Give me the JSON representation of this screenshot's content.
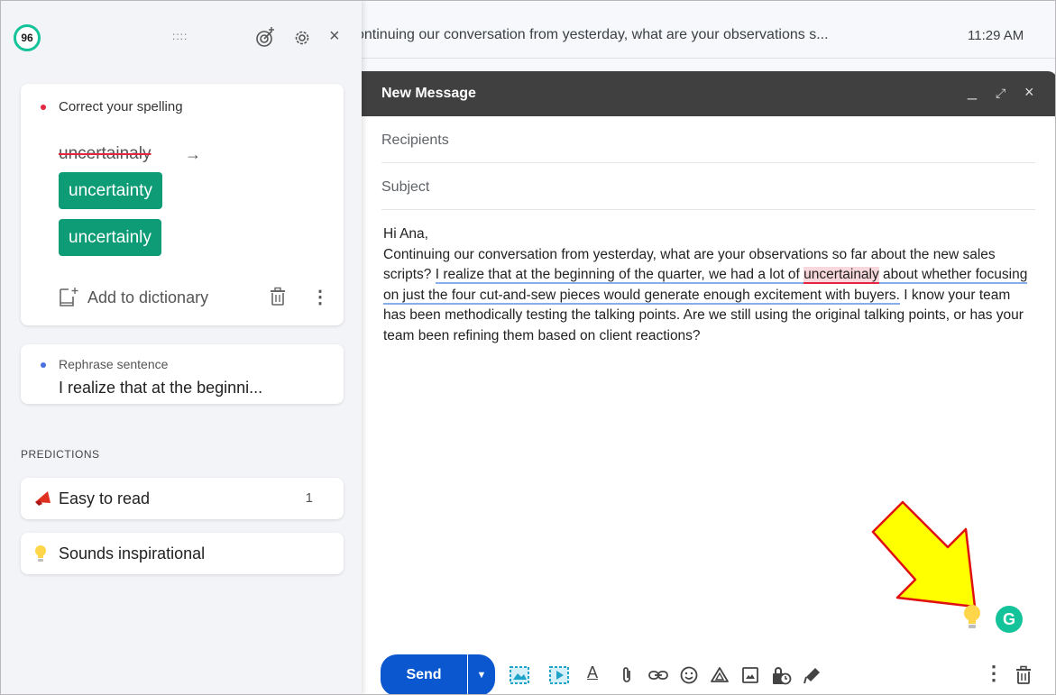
{
  "inbox": {
    "snippet": "ontinuing our conversation from yesterday, what are your observations s...",
    "time": "11:29 AM"
  },
  "panel": {
    "score": "96",
    "drag_handle": "::::",
    "close": "×",
    "spelling": {
      "label": "Correct your spelling",
      "original": "uncertainaly",
      "arrow": "→",
      "suggestion_1": "uncertainty",
      "suggestion_2": "uncertainly",
      "add_to_dictionary": "Add to dictionary",
      "more": "⋮"
    },
    "rephrase": {
      "label": "Rephrase sentence",
      "preview": "I realize that at the beginni..."
    },
    "predictions": {
      "heading": "PREDICTIONS",
      "items": [
        {
          "label": "Easy to read",
          "count": "1"
        },
        {
          "label": "Sounds inspirational"
        }
      ]
    }
  },
  "compose": {
    "title": "New Message",
    "minimize": "_",
    "expand": "⤢",
    "close": "×",
    "recipients_placeholder": "Recipients",
    "subject_placeholder": "Subject",
    "body": {
      "greeting": "Hi Ana,",
      "p1": "Continuing our conversation from yesterday, what are your observations so far about the new sales scripts? ",
      "s1a": "I realize that at the beginning of the quarter, we had a lot of ",
      "misspelled": "uncertainaly",
      "s1b": " about whether focusing on just the four cut-and-sew pieces would generate enough excitement with buyers.",
      "p2": " I know your team has been methodically testing the talking points. Are we still using the original talking points, or has your team been refining them based on client reactions?"
    },
    "grammarly_badge": "G"
  },
  "toolbar": {
    "send_label": "Send",
    "send_options": "▼",
    "format_label": "A",
    "more": "⋮"
  },
  "colors": {
    "grammarly_green": "#15c39a",
    "suggestion_green": "#0e9c76",
    "error_red": "#e5253f",
    "send_blue": "#0b57d0",
    "header_dark": "#404040",
    "arrow_yellow": "#ffff00"
  }
}
